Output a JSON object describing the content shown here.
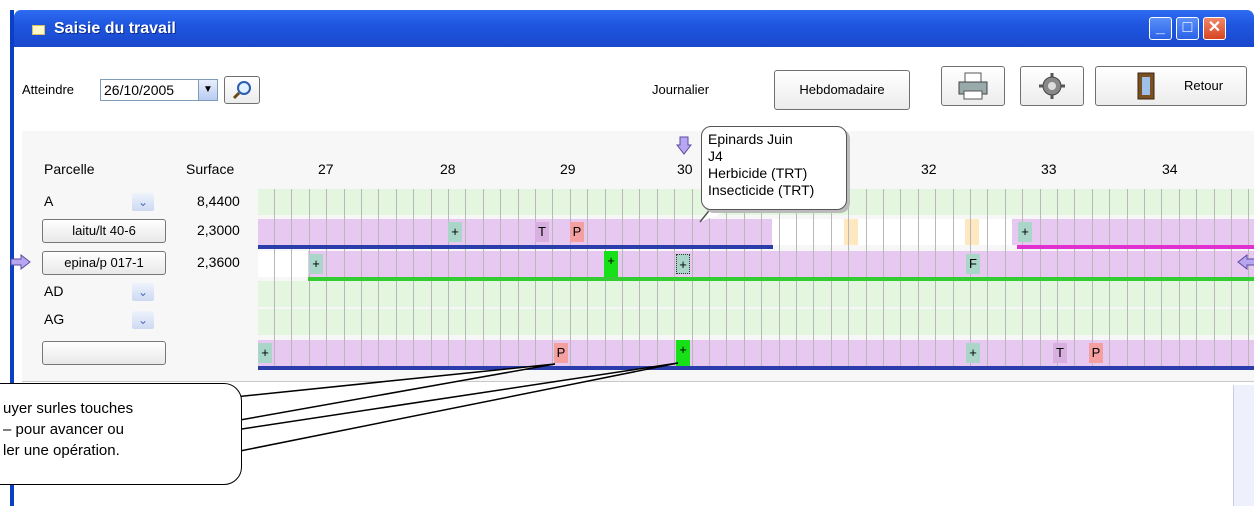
{
  "window": {
    "title": "Saisie du travail"
  },
  "toolbar": {
    "goto_label": "Atteindre",
    "date_value": "26/10/2005",
    "journalier_label": "Journalier",
    "hebdomadaire_label": "Hebdomadaire",
    "retour_label": "Retour"
  },
  "grid": {
    "col_parcelle": "Parcelle",
    "col_surface": "Surface",
    "weeks": [
      "27",
      "28",
      "29",
      "30",
      "32",
      "33",
      "34"
    ],
    "rows": [
      {
        "parcelle": "A",
        "surface": "8,4400"
      },
      {
        "parcelle": "laitu/lt 40-6",
        "surface": "2,3000"
      },
      {
        "parcelle": "epina/p 017-1",
        "surface": "2,3600"
      },
      {
        "parcelle": "AD",
        "surface": ""
      },
      {
        "parcelle": "AG",
        "surface": ""
      },
      {
        "parcelle": "",
        "surface": ""
      }
    ],
    "marks": {
      "plus": "+",
      "T": "T",
      "P": "P",
      "F": "F"
    }
  },
  "tooltip": {
    "line1": "Epinards Juin",
    "line2": "J4",
    "line3": "Herbicide (TRT)",
    "line4": "Insecticide (TRT)"
  },
  "note": {
    "line1": "uyer surles touches",
    "line2": "– pour avancer ou",
    "line3": "ler une opération."
  },
  "colors": {
    "titlebar": "#1f56e0",
    "row_green": "#e4f5e0",
    "row_pink": "#e6c8f0",
    "bar_blue": "#2a3dab",
    "bar_green": "#33cc33",
    "bar_magenta": "#e030d0"
  }
}
